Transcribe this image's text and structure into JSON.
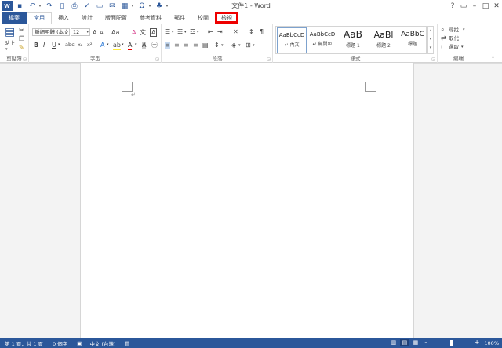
{
  "title_bar": {
    "doc_title": "文件1 - Word",
    "quick_access": [
      "word-logo-icon",
      "save-icon",
      "undo-icon",
      "redo-icon",
      "new-icon",
      "print-preview-icon",
      "spelling-icon",
      "open-icon",
      "email-icon",
      "table-icon",
      "symbol-icon",
      "shapes-icon",
      "customize-icon"
    ],
    "controls": {
      "help": "?",
      "restore": "▭",
      "minimize": "–",
      "maximize": "□",
      "close": "✕"
    }
  },
  "tabs": [
    {
      "label": "檔案",
      "name": "tab-file"
    },
    {
      "label": "常用",
      "name": "tab-home"
    },
    {
      "label": "插入",
      "name": "tab-insert"
    },
    {
      "label": "設計",
      "name": "tab-design"
    },
    {
      "label": "版面配置",
      "name": "tab-layout"
    },
    {
      "label": "參考資料",
      "name": "tab-references"
    },
    {
      "label": "郵件",
      "name": "tab-mailings"
    },
    {
      "label": "校閱",
      "name": "tab-review"
    },
    {
      "label": "檢視",
      "name": "tab-view"
    }
  ],
  "ribbon": {
    "clipboard": {
      "label": "剪貼簿",
      "paste_label": "貼上"
    },
    "font": {
      "label": "字型",
      "font_name": "新細明體 (本文",
      "font_size": "12"
    },
    "paragraph": {
      "label": "段落"
    },
    "styles": {
      "label": "樣式",
      "items": [
        {
          "preview": "AaBbCcD",
          "name": "↵ 內文"
        },
        {
          "preview": "AaBbCcD",
          "name": "↵ 無間距"
        },
        {
          "preview": "AaB",
          "name": "標題 1"
        },
        {
          "preview": "AaBl",
          "name": "標題 2"
        },
        {
          "preview": "AaBbC",
          "name": "標題"
        }
      ]
    },
    "editing": {
      "label": "編輯",
      "find": "尋找",
      "replace": "取代",
      "select": "選取"
    }
  },
  "document": {
    "para_mark": "↵"
  },
  "status_bar": {
    "page": "第 1 頁，共 1 頁",
    "words": "0 個字",
    "language": "中文 (台灣)",
    "zoom": "100%"
  },
  "colors": {
    "accent": "#2b579a",
    "highlight_box": "#e00000"
  }
}
